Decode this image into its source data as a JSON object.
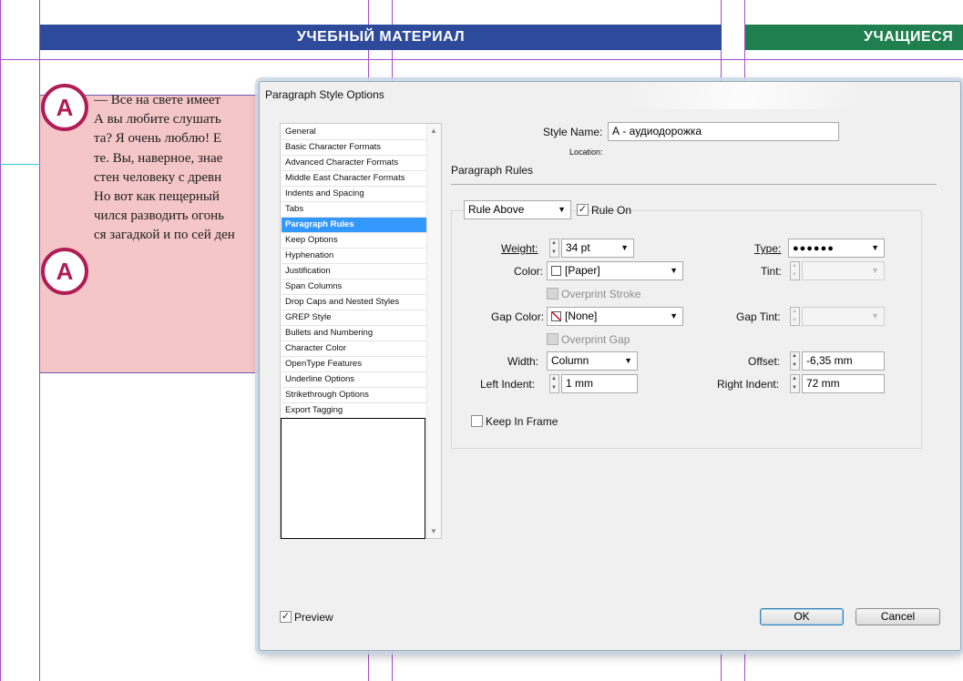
{
  "document": {
    "banner_left": "УЧЕБНЫЙ МАТЕРИАЛ",
    "banner_right": "УЧАЩИЕСЯ",
    "badge_letter": "A",
    "body_lines": [
      "— Все на свете имеет",
      "А вы любите слушать",
      "та? Я очень люблю! Е",
      "те. Вы, наверное, знае",
      "стен человеку с древн",
      "Но вот как пещерный",
      "чился разводить огонь",
      "ся загадкой и по сей ден"
    ]
  },
  "dialog": {
    "title": "Paragraph Style Options",
    "categories": [
      "General",
      "Basic Character Formats",
      "Advanced Character Formats",
      "Middle East Character Formats",
      "Indents and Spacing",
      "Tabs",
      "Paragraph Rules",
      "Keep Options",
      "Hyphenation",
      "Justification",
      "Span Columns",
      "Drop Caps and Nested Styles",
      "GREP Style",
      "Bullets and Numbering",
      "Character Color",
      "OpenType Features",
      "Underline Options",
      "Strikethrough Options",
      "Export Tagging"
    ],
    "selected_category": "Paragraph Rules",
    "style_name_label": "Style Name:",
    "style_name_value": "А - аудиодорожка",
    "location_label": "Location:",
    "section_title": "Paragraph Rules",
    "rule_select": "Rule Above",
    "rule_on_label": "Rule On",
    "rule_on_checked": true,
    "weight_label": "Weight:",
    "weight_value": "34 pt",
    "type_label": "Type:",
    "type_value": "●●●●●●",
    "color_label": "Color:",
    "color_value": "[Paper]",
    "tint_label": "Tint:",
    "tint_value": "",
    "overprint_stroke_label": "Overprint Stroke",
    "gap_color_label": "Gap Color:",
    "gap_color_value": "[None]",
    "gap_tint_label": "Gap Tint:",
    "gap_tint_value": "",
    "overprint_gap_label": "Overprint Gap",
    "width_label": "Width:",
    "width_value": "Column",
    "offset_label": "Offset:",
    "offset_value": "-6,35 mm",
    "left_indent_label": "Left Indent:",
    "left_indent_value": "1 mm",
    "right_indent_label": "Right Indent:",
    "right_indent_value": "72 mm",
    "keep_in_frame_label": "Keep In Frame",
    "keep_in_frame_checked": false,
    "preview_label": "Preview",
    "preview_checked": true,
    "ok_label": "OK",
    "cancel_label": "Cancel"
  },
  "colors": {
    "banner_blue": "#2e4a9a",
    "banner_green": "#1f7f4e",
    "badge_magenta": "#b01c54",
    "selection_blue": "#3399ff",
    "pink_frame": "#f4c6c7"
  }
}
